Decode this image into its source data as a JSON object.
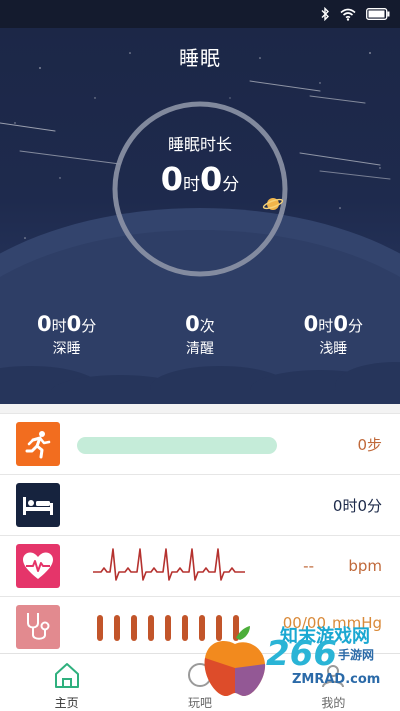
{
  "page": {
    "title": "睡眠"
  },
  "status_bar": {
    "icons": [
      "bluetooth-icon",
      "wifi-icon",
      "battery-icon"
    ]
  },
  "sleep": {
    "duration_label": "睡眠时长",
    "hours": "0",
    "hours_unit": "时",
    "minutes": "0",
    "minutes_unit": "分",
    "ring_progress": 0,
    "stats": [
      {
        "hours": "0",
        "hours_unit": "时",
        "minutes": "0",
        "minutes_unit": "分",
        "label": "深睡"
      },
      {
        "count": "0",
        "count_unit": "次",
        "label": "清醒"
      },
      {
        "hours": "0",
        "hours_unit": "时",
        "minutes": "0",
        "minutes_unit": "分",
        "label": "浅睡"
      }
    ]
  },
  "rows": {
    "steps": {
      "icon": "running-icon",
      "value": "0步",
      "progress": 0,
      "color": "#f26d1f"
    },
    "sleep": {
      "icon": "bed-icon",
      "value": "0时0分",
      "color": "#16233e"
    },
    "heart_rate": {
      "icon": "heart-rate-icon",
      "value": "--",
      "unit": "bpm",
      "color": "#e5356a"
    },
    "blood_pressure": {
      "icon": "stethoscope-icon",
      "value": "00/00",
      "unit": "mmHg",
      "color": "#e28a8f"
    }
  },
  "nav": {
    "items": [
      {
        "label": "主页",
        "icon": "home-icon",
        "active": true
      },
      {
        "label": "玩吧",
        "icon": "play-icon",
        "active": false
      },
      {
        "label": "我的",
        "icon": "profile-icon",
        "active": false
      }
    ]
  },
  "watermark": {
    "line1": "知末游戏网",
    "line2": "手游网",
    "line3": "ZMRAD.com",
    "brand": "266"
  },
  "colors": {
    "accent": "#2fb07e",
    "hero_bg": "#1e2a4d",
    "value_text": "#c0693a"
  }
}
